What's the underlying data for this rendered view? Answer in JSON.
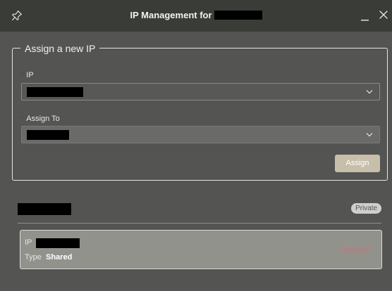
{
  "window": {
    "title": "IP Management for"
  },
  "assign_section": {
    "legend": "Assign a new IP",
    "ip_field": {
      "label": "IP"
    },
    "assign_to_field": {
      "label": "Assign To"
    },
    "assign_button": "Assign"
  },
  "ip_list": {
    "badge": "Private",
    "items": [
      {
        "ip_key": "IP",
        "type_key": "Type",
        "type_value": "Shared",
        "action": "Unassign"
      }
    ]
  },
  "colors": {
    "titlebar": "#3a3c38",
    "background": "#545452",
    "assign_button": "#c7bfaa",
    "card": "#92928d",
    "unassign": "#d76b73",
    "required_marker": "#7a3a3a"
  },
  "icons": [
    "pin-icon",
    "minimize-icon",
    "close-icon",
    "chevron-down-icon"
  ]
}
